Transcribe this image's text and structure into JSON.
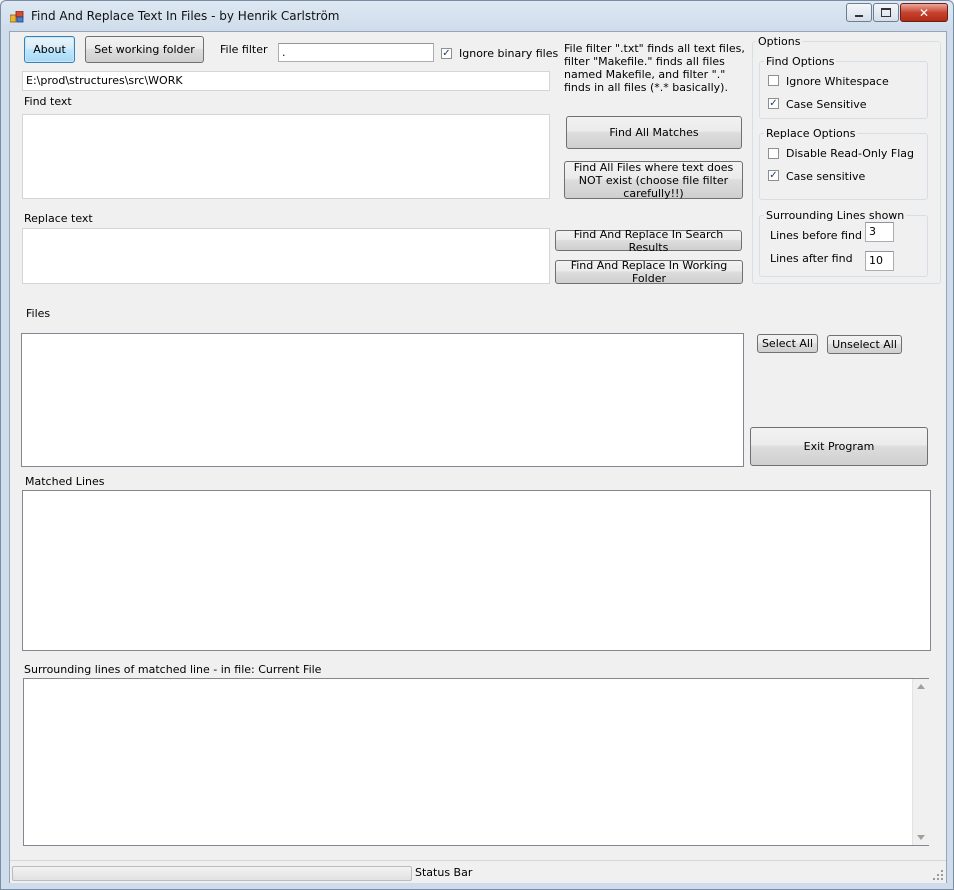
{
  "window": {
    "title": "Find And Replace Text In Files - by Henrik Carlström",
    "controls": {
      "minimize_icon": "minimize-icon",
      "maximize_icon": "maximize-icon",
      "close_icon": "close-icon"
    }
  },
  "toolbar": {
    "about_label": "About",
    "set_folder_label": "Set working folder",
    "file_filter_label": "File filter",
    "file_filter_value": ".",
    "ignore_binary_label": "Ignore binary files",
    "ignore_binary_checked": true
  },
  "working_folder": "E:\\prod\\structures\\src\\WORK",
  "help_text": "File filter \".txt\" finds all text files, filter \"Makefile.\" finds all files named Makefile, and filter \".\" finds in all files (*.* basically).",
  "find": {
    "label": "Find text",
    "value": "",
    "find_all_label": "Find All Matches",
    "find_not_label": "Find All Files where text does NOT exist (choose file filter carefully!!)"
  },
  "replace": {
    "label": "Replace text",
    "value": "",
    "in_results_label": "Find And Replace In Search Results",
    "in_folder_label": "Find And Replace In Working Folder"
  },
  "options": {
    "title": "Options",
    "find_options": {
      "title": "Find Options",
      "ignore_whitespace_label": "Ignore Whitespace",
      "ignore_whitespace_checked": false,
      "case_sensitive_label": "Case Sensitive",
      "case_sensitive_checked": true
    },
    "replace_options": {
      "title": "Replace Options",
      "disable_readonly_label": "Disable Read-Only Flag",
      "disable_readonly_checked": false,
      "case_sensitive_label": "Case sensitive",
      "case_sensitive_checked": true
    },
    "surrounding": {
      "title": "Surrounding Lines shown",
      "before_label": "Lines before find",
      "before_value": "3",
      "after_label": "Lines after find",
      "after_value": "10"
    }
  },
  "files": {
    "label": "Files",
    "select_all_label": "Select All",
    "unselect_all_label": "Unselect All",
    "exit_label": "Exit Program"
  },
  "matched_lines": {
    "label": "Matched Lines"
  },
  "surrounding_view": {
    "label": "Surrounding lines of matched line - in file: Current File"
  },
  "status_bar": {
    "text": "Status Bar",
    "progress": 0
  }
}
